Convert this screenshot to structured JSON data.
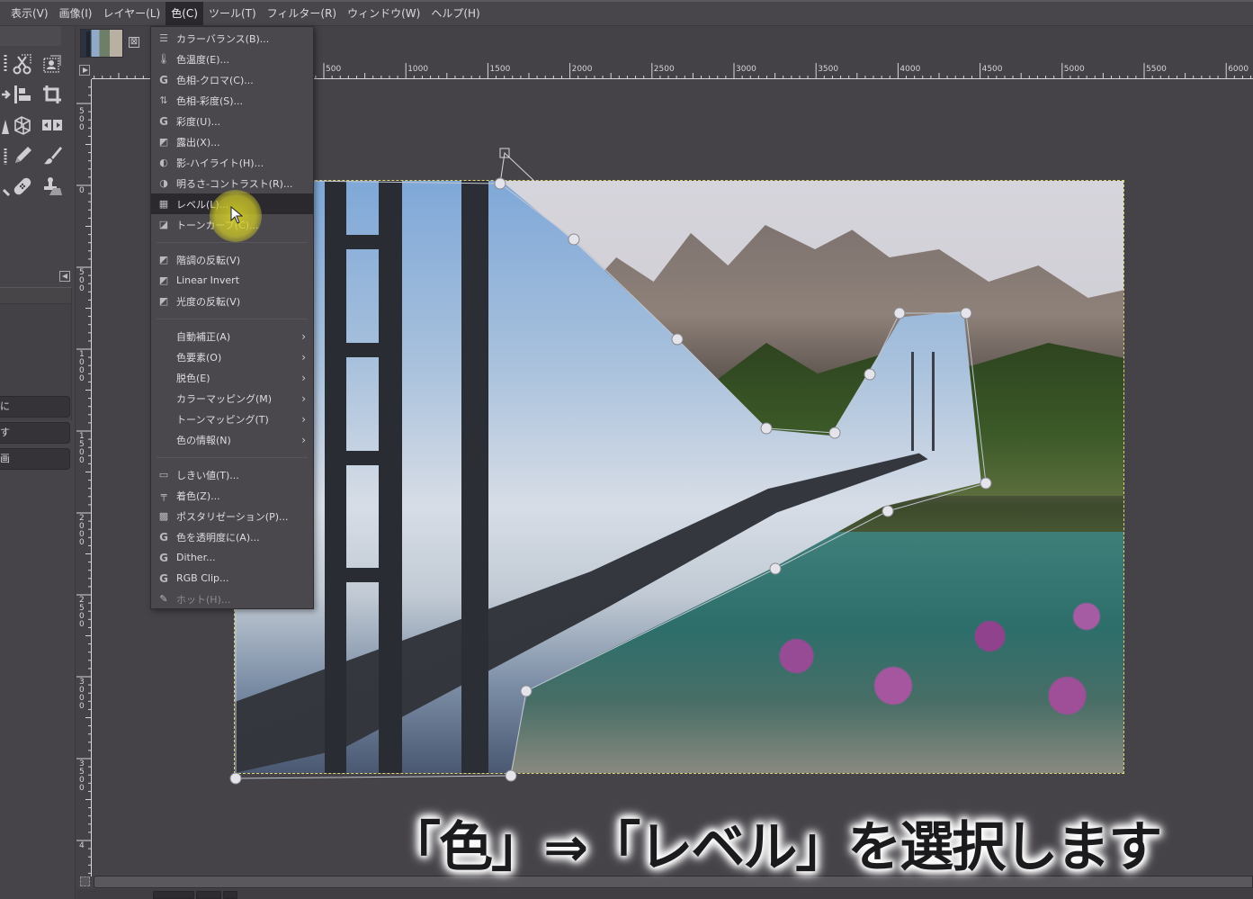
{
  "menubar": {
    "items": [
      {
        "label": "表示(V)"
      },
      {
        "label": "画像(I)"
      },
      {
        "label": "レイヤー(L)"
      },
      {
        "label": "色(C)",
        "active": true
      },
      {
        "label": "ツール(T)"
      },
      {
        "label": "フィルター(R)"
      },
      {
        "label": "ウィンドウ(W)"
      },
      {
        "label": "ヘルプ(H)"
      }
    ]
  },
  "toolbox": {
    "tools": [
      "free-select",
      "scissors-select",
      "foreground-select",
      "move",
      "align",
      "crop",
      "unified-transform",
      "perspective",
      "flip",
      "paintbrush-ink",
      "pencil",
      "paintbrush",
      "smudge",
      "heal",
      "clone"
    ],
    "dock_buttons": [
      "に",
      "す",
      "画"
    ]
  },
  "image_tab": {
    "close_label": "⊠"
  },
  "rulers": {
    "horizontal": [
      "500",
      "1000",
      "1500",
      "2000",
      "2500",
      "3000",
      "3500",
      "4000",
      "4500",
      "5000",
      "5500",
      "6000"
    ],
    "vertical": [
      "500",
      "0",
      "500",
      "1000",
      "1500",
      "2000",
      "2500",
      "3000",
      "3500",
      "4"
    ]
  },
  "colors_menu": {
    "items": [
      {
        "type": "item",
        "icon": "color-balance-icon",
        "glyph": "☰",
        "label": "カラーバランス(B)..."
      },
      {
        "type": "item",
        "icon": "thermometer-icon",
        "glyph": "🌡",
        "label": "色温度(E)..."
      },
      {
        "type": "item",
        "icon": "gegl-icon",
        "glyph": "G",
        "label": "色相-クロマ(C)..."
      },
      {
        "type": "item",
        "icon": "hue-saturation-icon",
        "glyph": "⇅",
        "label": "色相-彩度(S)..."
      },
      {
        "type": "item",
        "icon": "gegl-icon",
        "glyph": "G",
        "label": "彩度(U)..."
      },
      {
        "type": "item",
        "icon": "exposure-icon",
        "glyph": "◩",
        "label": "露出(X)..."
      },
      {
        "type": "item",
        "icon": "shadows-highlights-icon",
        "glyph": "◐",
        "label": "影-ハイライト(H)..."
      },
      {
        "type": "item",
        "icon": "brightness-contrast-icon",
        "glyph": "◑",
        "label": "明るさ-コントラスト(R)..."
      },
      {
        "type": "item",
        "icon": "levels-icon",
        "glyph": "▦",
        "label": "レベル(L)...",
        "highlight": true
      },
      {
        "type": "item",
        "icon": "curves-icon",
        "glyph": "◪",
        "label": "トーンカーブ(C)..."
      },
      {
        "type": "separator"
      },
      {
        "type": "item",
        "icon": "invert-icon",
        "glyph": "◩",
        "label": "階調の反転(V)"
      },
      {
        "type": "item",
        "icon": "invert-icon",
        "glyph": "◩",
        "label": "Linear Invert"
      },
      {
        "type": "item",
        "icon": "invert-icon",
        "glyph": "◩",
        "label": "光度の反転(V)"
      },
      {
        "type": "separator"
      },
      {
        "type": "submenu",
        "label": "自動補正(A)"
      },
      {
        "type": "submenu",
        "label": "色要素(O)"
      },
      {
        "type": "submenu",
        "label": "脱色(E)"
      },
      {
        "type": "submenu",
        "label": "カラーマッピング(M)"
      },
      {
        "type": "submenu",
        "label": "トーンマッピング(T)"
      },
      {
        "type": "submenu",
        "label": "色の情報(N)"
      },
      {
        "type": "separator"
      },
      {
        "type": "item",
        "icon": "threshold-icon",
        "glyph": "▭",
        "label": "しきい値(T)..."
      },
      {
        "type": "item",
        "icon": "colorize-icon",
        "glyph": "╤",
        "label": "着色(Z)..."
      },
      {
        "type": "item",
        "icon": "posterize-icon",
        "glyph": "▩",
        "label": "ポスタリゼーション(P)..."
      },
      {
        "type": "item",
        "icon": "gegl-icon",
        "glyph": "G",
        "label": "色を透明度に(A)..."
      },
      {
        "type": "item",
        "icon": "gegl-icon",
        "glyph": "G",
        "label": "Dither..."
      },
      {
        "type": "item",
        "icon": "gegl-icon",
        "glyph": "G",
        "label": "RGB Clip..."
      },
      {
        "type": "item",
        "icon": "hot-icon",
        "glyph": "✎",
        "label": "ホット(H)...",
        "disabled": true
      }
    ],
    "submenu_arrow": "›"
  },
  "caption": {
    "text": "「色」⇒「レベル」を選択します"
  },
  "colors": {
    "accent_halo": "#d8d428",
    "menu_bg": "#4a474d",
    "highlight_bg": "#2b292e",
    "canvas_bg": "#454248"
  }
}
